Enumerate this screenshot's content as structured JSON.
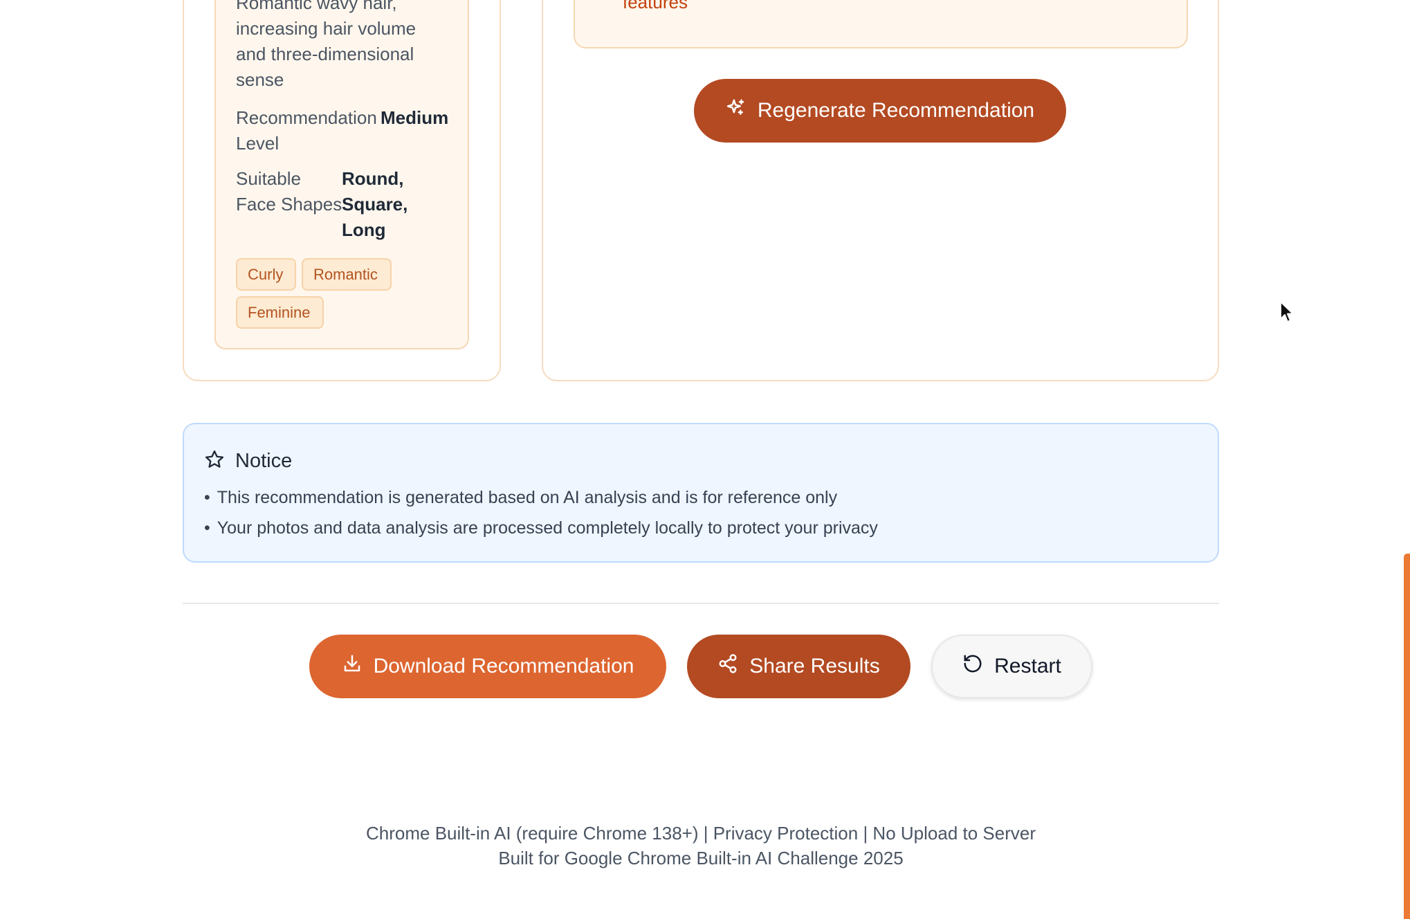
{
  "style_card": {
    "description": "Romantic wavy hair, increasing hair volume and three-dimensional sense",
    "recommendation_label": "Recommendation Level",
    "recommendation_value": "Medium",
    "face_shapes_label": "Suitable Face Shapes",
    "face_shapes_value": "Round, Square, Long",
    "tags": [
      "Curly",
      "Romantic",
      "Feminine"
    ]
  },
  "features_text": "features",
  "regenerate_label": "Regenerate Recommendation",
  "notice": {
    "title": "Notice",
    "lines": [
      "This recommendation is generated based on AI analysis and is for reference only",
      "Your photos and data analysis are processed completely locally to protect your privacy"
    ]
  },
  "actions": {
    "download_label": "Download Recommendation",
    "share_label": "Share Results",
    "restart_label": "Restart"
  },
  "footer": {
    "line1": "Chrome Built-in AI (require Chrome 138+) | Privacy Protection | No Upload to Server",
    "line2": "Built for Google Chrome Built-in AI Challenge 2025"
  },
  "colors": {
    "accent_orange": "#dd6530",
    "accent_brown": "#b34a22",
    "notice_bg": "#eff6ff",
    "card_bg": "#fff7ed"
  },
  "icons": {
    "regenerate": "sparkles-icon",
    "notice": "star-icon",
    "download": "download-icon",
    "share": "share-icon",
    "restart": "rotate-ccw-icon"
  }
}
